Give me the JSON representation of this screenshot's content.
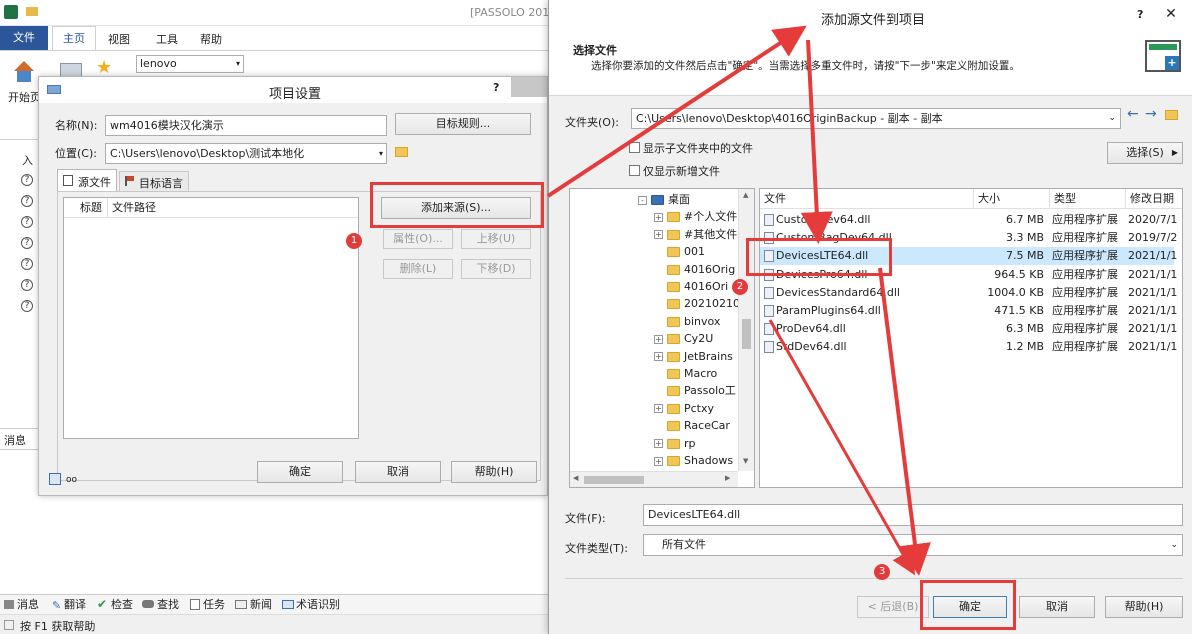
{
  "bg": {
    "title": "[PASSOLO 201",
    "tabs": [
      "文件",
      "主页",
      "视图",
      "工具",
      "帮助"
    ],
    "combo": "lenovo",
    "start_label": "开始页",
    "side_label": "入",
    "msg_label": "消息",
    "statusbar": [
      "消息",
      "翻译",
      "检查",
      "查找",
      "任务",
      "新闻",
      "术语识别"
    ],
    "help_hint": "按 F1 获取帮助"
  },
  "project": {
    "title": "项目设置",
    "help": "?",
    "name_label": "名称(N):",
    "name_value": "wm4016模块汉化演示",
    "target_rules_btn": "目标规则...",
    "location_label": "位置(C):",
    "location_value": "C:\\Users\\lenovo\\Desktop\\测试本地化",
    "tab_source": "源文件",
    "tab_target": "目标语言",
    "col_title": "标题",
    "col_path": "文件路径",
    "add_source_btn": "添加来源(S)...",
    "props_btn": "属性(O)...",
    "up_btn": "上移(U)",
    "delete_btn": "删除(L)",
    "down_btn": "下移(D)",
    "ok_btn": "确定",
    "cancel_btn": "取消",
    "help_btn": "帮助(H)"
  },
  "addsrc": {
    "title": "添加源文件到项目",
    "help": "?",
    "close": "✕",
    "header_title": "选择文件",
    "header_desc": "选择你要添加的文件然后点击\"确定\"。当需选择多重文件时，请按\"下一步\"来定义附加设置。",
    "folder_label": "文件夹(O):",
    "folder_value": "C:\\Users\\lenovo\\Desktop\\4016OriginBackup - 副本 - 副本",
    "show_sub": "显示子文件夹中的文件",
    "only_new": "仅显示新增文件",
    "select_btn": "选择(S)",
    "tree": [
      {
        "label": "桌面",
        "expander": "-",
        "top": true
      },
      {
        "label": "#个人文件",
        "expander": "+"
      },
      {
        "label": "#其他文件",
        "expander": "+"
      },
      {
        "label": "001",
        "expander": ""
      },
      {
        "label": "4016Orig",
        "expander": ""
      },
      {
        "label": "4016Ori",
        "expander": ""
      },
      {
        "label": "20210210",
        "expander": ""
      },
      {
        "label": "binvox",
        "expander": ""
      },
      {
        "label": "Cy2U",
        "expander": "+"
      },
      {
        "label": "JetBrains",
        "expander": "+"
      },
      {
        "label": "Macro",
        "expander": ""
      },
      {
        "label": "Passolo工",
        "expander": ""
      },
      {
        "label": "Pctxy",
        "expander": "+"
      },
      {
        "label": "RaceCar",
        "expander": ""
      },
      {
        "label": "rp",
        "expander": "+"
      },
      {
        "label": "Shadows",
        "expander": "+"
      }
    ],
    "columns": [
      "文件",
      "大小",
      "类型",
      "修改日期"
    ],
    "files": [
      {
        "name": "CustomDev64.dll",
        "size": "6.7 MB",
        "type": "应用程序扩展",
        "date": "2020/7/1"
      },
      {
        "name": "CustomBagDev64.dll",
        "size": "3.3 MB",
        "type": "应用程序扩展",
        "date": "2019/7/2"
      },
      {
        "name": "DevicesLTE64.dll",
        "size": "7.5 MB",
        "type": "应用程序扩展",
        "date": "2021/1/1"
      },
      {
        "name": "DevicesPro64.dll",
        "size": "964.5 KB",
        "type": "应用程序扩展",
        "date": "2021/1/1"
      },
      {
        "name": "DevicesStandard64.dll",
        "size": "1004.0 KB",
        "type": "应用程序扩展",
        "date": "2021/1/1"
      },
      {
        "name": "ParamPlugins64.dll",
        "size": "471.5 KB",
        "type": "应用程序扩展",
        "date": "2021/1/1"
      },
      {
        "name": "ProDev64.dll",
        "size": "6.3 MB",
        "type": "应用程序扩展",
        "date": "2021/1/1"
      },
      {
        "name": "StdDev64.dll",
        "size": "1.2 MB",
        "type": "应用程序扩展",
        "date": "2021/1/1"
      }
    ],
    "filename_label": "文件(F):",
    "filename_value": "DevicesLTE64.dll",
    "filetype_label": "文件类型(T):",
    "filetype_value": "所有文件",
    "back_btn": "< 后退(B)",
    "ok_btn": "确定",
    "cancel_btn": "取消",
    "help_btn": "帮助(H)"
  },
  "annotations": [
    "1",
    "2",
    "3"
  ],
  "colors": {
    "accent": "#2b579a",
    "annotation": "#e53b3b",
    "selection": "#cce8ff"
  }
}
